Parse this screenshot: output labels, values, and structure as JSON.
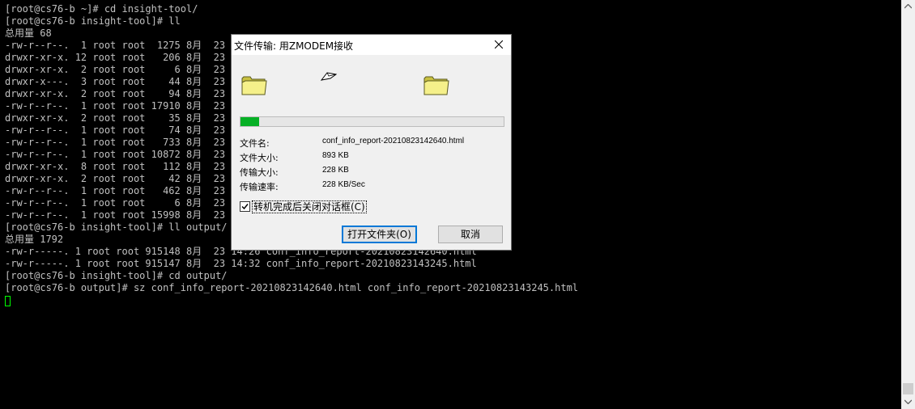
{
  "terminal": {
    "lines": [
      "[root@cs76-b ~]# cd insight-tool/",
      "[root@cs76-b insight-tool]# ll",
      "总用量 68",
      "-rw-r--r--.  1 root root  1275 8月  23 1",
      "drwxr-xr-x. 12 root root   206 8月  23 1",
      "drwxr-xr-x.  2 root root     6 8月  23 1",
      "drwxr-x---.  3 root root    44 8月  23 1",
      "drwxr-xr-x.  2 root root    94 8月  23 1",
      "-rw-r--r--.  1 root root 17910 8月  23 1",
      "drwxr-xr-x.  2 root root    35 8月  23 1",
      "-rw-r--r--.  1 root root    74 8月  23 1",
      "-rw-r--r--.  1 root root   733 8月  23 1",
      "-rw-r--r--.  1 root root 10872 8月  23 1",
      "drwxr-xr-x.  8 root root   112 8月  23 1",
      "drwxr-xr-x.  2 root root    42 8月  23 1",
      "-rw-r--r--.  1 root root   462 8月  23 1",
      "-rw-r--r--.  1 root root     6 8月  23 1",
      "-rw-r--r--.  1 root root 15998 8月  23 1",
      "[root@cs76-b insight-tool]# ll output/",
      "总用量 1792",
      "-rw-r-----. 1 root root 915148 8月  23 14:26 conf_info_report-20210823142640.html",
      "-rw-r-----. 1 root root 915147 8月  23 14:32 conf_info_report-20210823143245.html",
      "[root@cs76-b insight-tool]# cd output/",
      "[root@cs76-b output]# sz conf_info_report-20210823142640.html conf_info_report-20210823143245.html"
    ],
    "cursor_color": "#00ff00"
  },
  "dialog": {
    "title": "文件传输: 用ZMODEM接收",
    "progress_fraction": 0.07,
    "progress_color": "#06b025",
    "labels": {
      "filename": "文件名:",
      "filesize": "文件大小:",
      "transferred": "传输大小:",
      "rate": "传输速率:"
    },
    "values": {
      "filename": "conf_info_report-20210823142640.html",
      "filesize": "893 KB",
      "transferred": "228 KB",
      "rate": "228 KB/Sec"
    },
    "close_on_complete": {
      "checked": true,
      "label": "转机完成后关闭对话框(C)"
    },
    "buttons": {
      "open_folder": "打开文件夹(O)",
      "cancel": "取消"
    },
    "icons": {
      "source": "folder-icon",
      "destination": "folder-icon",
      "transfer": "flying-paper-icon",
      "close": "close-icon"
    }
  }
}
